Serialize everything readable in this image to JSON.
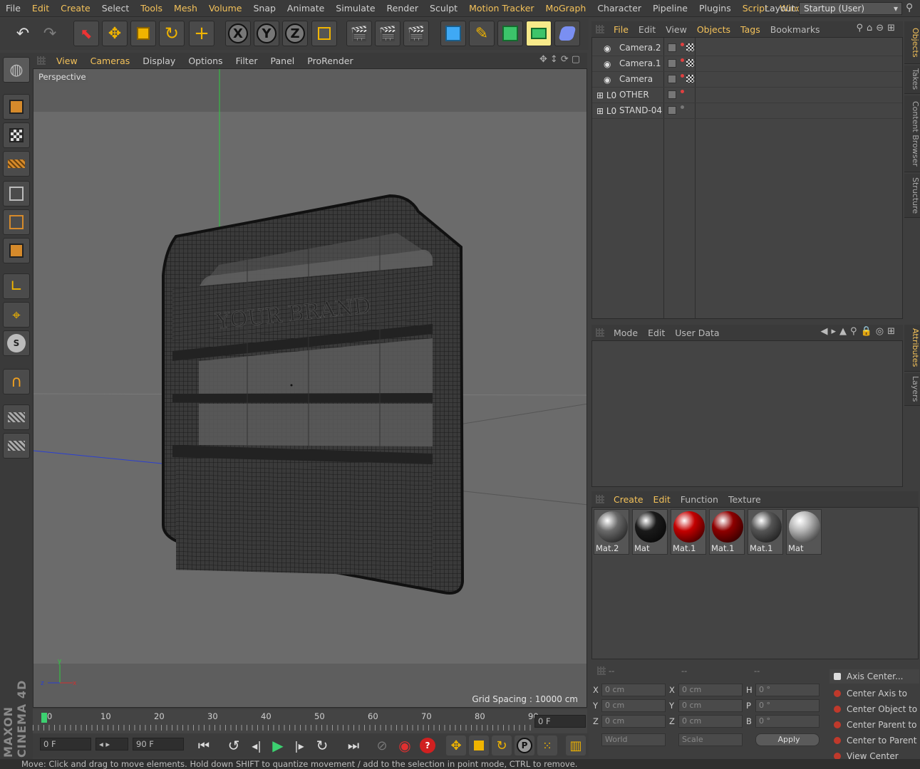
{
  "menubar": {
    "items": [
      {
        "label": "File",
        "hl": false
      },
      {
        "label": "Edit",
        "hl": true
      },
      {
        "label": "Create",
        "hl": true
      },
      {
        "label": "Select",
        "hl": false
      },
      {
        "label": "Tools",
        "hl": true
      },
      {
        "label": "Mesh",
        "hl": true
      },
      {
        "label": "Volume",
        "hl": true
      },
      {
        "label": "Snap",
        "hl": false
      },
      {
        "label": "Animate",
        "hl": false
      },
      {
        "label": "Simulate",
        "hl": false
      },
      {
        "label": "Render",
        "hl": false
      },
      {
        "label": "Sculpt",
        "hl": false
      },
      {
        "label": "Motion Tracker",
        "hl": true
      },
      {
        "label": "MoGraph",
        "hl": true
      },
      {
        "label": "Character",
        "hl": false
      },
      {
        "label": "Pipeline",
        "hl": false
      },
      {
        "label": "Plugins",
        "hl": false
      },
      {
        "label": "Script",
        "hl": true
      },
      {
        "label": "Winc",
        "hl": true
      }
    ],
    "layout_label": "Layout:",
    "layout_value": "Startup (User)"
  },
  "viewport_menu": {
    "items": [
      {
        "label": "View",
        "hl": true
      },
      {
        "label": "Cameras",
        "hl": true
      },
      {
        "label": "Display",
        "hl": false
      },
      {
        "label": "Options",
        "hl": false
      },
      {
        "label": "Filter",
        "hl": false
      },
      {
        "label": "Panel",
        "hl": false
      },
      {
        "label": "ProRender",
        "hl": false
      }
    ],
    "camera_label": "Perspective",
    "grid_spacing": "Grid Spacing : 10000 cm",
    "brand_text": "YOUR BRAND"
  },
  "toolbar": {
    "x_label": "X",
    "y_label": "Y",
    "z_label": "Z"
  },
  "timeline": {
    "ticks": [
      "0",
      "10",
      "20",
      "30",
      "40",
      "50",
      "60",
      "70",
      "80",
      "90"
    ],
    "current_frame": "0 F"
  },
  "transport": {
    "start_frame": "0 F",
    "end_frame": "90 F"
  },
  "objects_panel": {
    "menu": [
      {
        "label": "File",
        "hl": true
      },
      {
        "label": "Edit",
        "hl": false
      },
      {
        "label": "View",
        "hl": false
      },
      {
        "label": "Objects",
        "hl": true
      },
      {
        "label": "Tags",
        "hl": true
      },
      {
        "label": "Bookmarks",
        "hl": false
      }
    ],
    "rows": [
      {
        "name": "Camera.2",
        "type": "camera"
      },
      {
        "name": "Camera.1",
        "type": "camera"
      },
      {
        "name": "Camera",
        "type": "camera"
      },
      {
        "name": "OTHER",
        "type": "null"
      },
      {
        "name": "STAND-04",
        "type": "null"
      }
    ]
  },
  "attributes_panel": {
    "menu": [
      {
        "label": "Mode",
        "hl": false
      },
      {
        "label": "Edit",
        "hl": false
      },
      {
        "label": "User Data",
        "hl": false
      }
    ]
  },
  "materials_panel": {
    "menu": [
      {
        "label": "Create",
        "hl": true
      },
      {
        "label": "Edit",
        "hl": true
      },
      {
        "label": "Function",
        "hl": false
      },
      {
        "label": "Texture",
        "hl": false
      }
    ],
    "materials": [
      {
        "name": "Mat.2",
        "color": "#6a6a6a"
      },
      {
        "name": "Mat",
        "color": "#1a1a1a"
      },
      {
        "name": "Mat.1",
        "color": "#c40000"
      },
      {
        "name": "Mat.1",
        "color": "#8f0000"
      },
      {
        "name": "Mat.1",
        "color": "#555555"
      },
      {
        "name": "Mat",
        "color": "#b5b5b5"
      }
    ]
  },
  "coordinates": {
    "headers": [
      "--",
      "--",
      "--"
    ],
    "pos_labels": [
      "X",
      "Y",
      "Z"
    ],
    "size_labels": [
      "X",
      "Y",
      "Z"
    ],
    "rot_labels": [
      "H",
      "P",
      "B"
    ],
    "pos_values": [
      "0 cm",
      "0 cm",
      "0 cm"
    ],
    "size_values": [
      "0 cm",
      "0 cm",
      "0 cm"
    ],
    "rot_values": [
      "0 °",
      "0 °",
      "0 °"
    ],
    "world_label": "World",
    "scale_label": "Scale",
    "apply_label": "Apply"
  },
  "axis_center": {
    "title": "Axis Center...",
    "items": [
      "Center Axis to",
      "Center Object to",
      "Center Parent to",
      "Center to Parent",
      "View Center"
    ]
  },
  "right_tabs": [
    "Objects",
    "Takes",
    "Content Browser",
    "Structure",
    "Attributes",
    "Layers"
  ],
  "status": "Move: Click and drag to move elements. Hold down SHIFT to quantize movement / add to the selection in point mode, CTRL to remove.",
  "branding": "MAXON CINEMA 4D",
  "colors": {
    "accent": "#f4c25a",
    "highlight_btn": "#f7e98a"
  }
}
